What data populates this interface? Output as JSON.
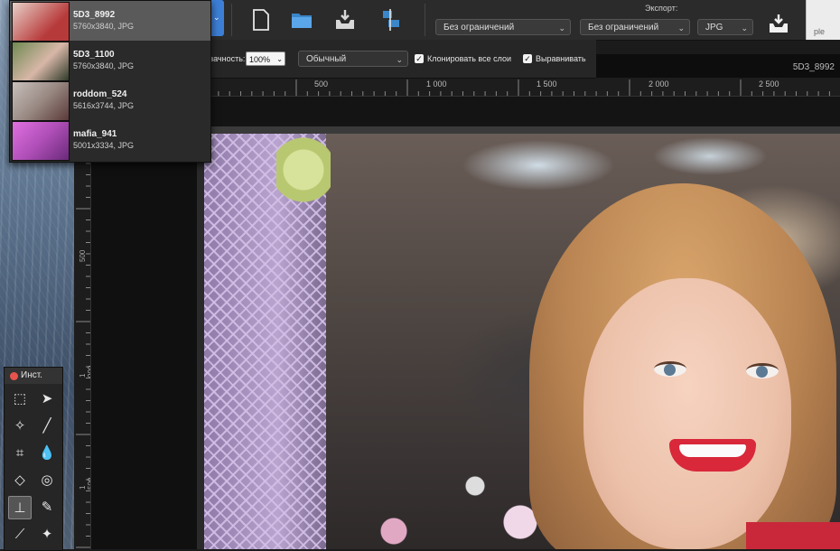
{
  "file_list": {
    "items": [
      {
        "name": "5D3_8992",
        "meta": "5760x3840,  JPG",
        "thumb_color": "#b73a3a",
        "selected": true
      },
      {
        "name": "5D3_1100",
        "meta": "5760x3840,  JPG",
        "thumb_color": "#4b6a3b",
        "selected": false
      },
      {
        "name": "roddom_524",
        "meta": "5616x3744,  JPG",
        "thumb_color": "#9a8a84",
        "selected": false
      },
      {
        "name": "mafia_941",
        "meta": "5001x3334,  JPG",
        "thumb_color": "#b04fb8",
        "selected": false
      }
    ]
  },
  "toolbar": {
    "icons": [
      "new-document-icon",
      "open-folder-icon",
      "save-tray-icon",
      "align-icon"
    ],
    "export_label": "Экспорт:",
    "export_size_1": "Без ограничений",
    "export_size_2": "Без ограничений",
    "export_format": "JPG",
    "right_window_text": "ple"
  },
  "options_bar": {
    "opacity_label": "зачность:",
    "opacity_value": "100%",
    "blend_mode": "Обычный",
    "clone_all_layers": "Клонировать все слои",
    "align": "Выравнивать"
  },
  "document": {
    "title": "5D3_8992"
  },
  "ruler": {
    "h_labels": [
      "500",
      "1 000",
      "1 500",
      "2 000",
      "2 500"
    ],
    "v_labels": [
      "500",
      "1 000",
      "1 500"
    ]
  },
  "tools": {
    "title": "Инст.",
    "items": [
      {
        "name": "marquee-tool",
        "glyph": "⬚"
      },
      {
        "name": "move-tool",
        "glyph": "➤"
      },
      {
        "name": "magic-wand-tool",
        "glyph": "✧"
      },
      {
        "name": "brush-tool",
        "glyph": "╱"
      },
      {
        "name": "crop-tool",
        "glyph": "⌗"
      },
      {
        "name": "drop-tool",
        "glyph": "💧"
      },
      {
        "name": "eraser-tool",
        "glyph": "◇"
      },
      {
        "name": "fill-tool",
        "glyph": "◎"
      },
      {
        "name": "clone-stamp-tool",
        "glyph": "⊥",
        "active": true
      },
      {
        "name": "healing-tool",
        "glyph": "✎"
      },
      {
        "name": "eyedropper-tool",
        "glyph": "⟋"
      },
      {
        "name": "color-replace-tool",
        "glyph": "✦"
      }
    ]
  }
}
